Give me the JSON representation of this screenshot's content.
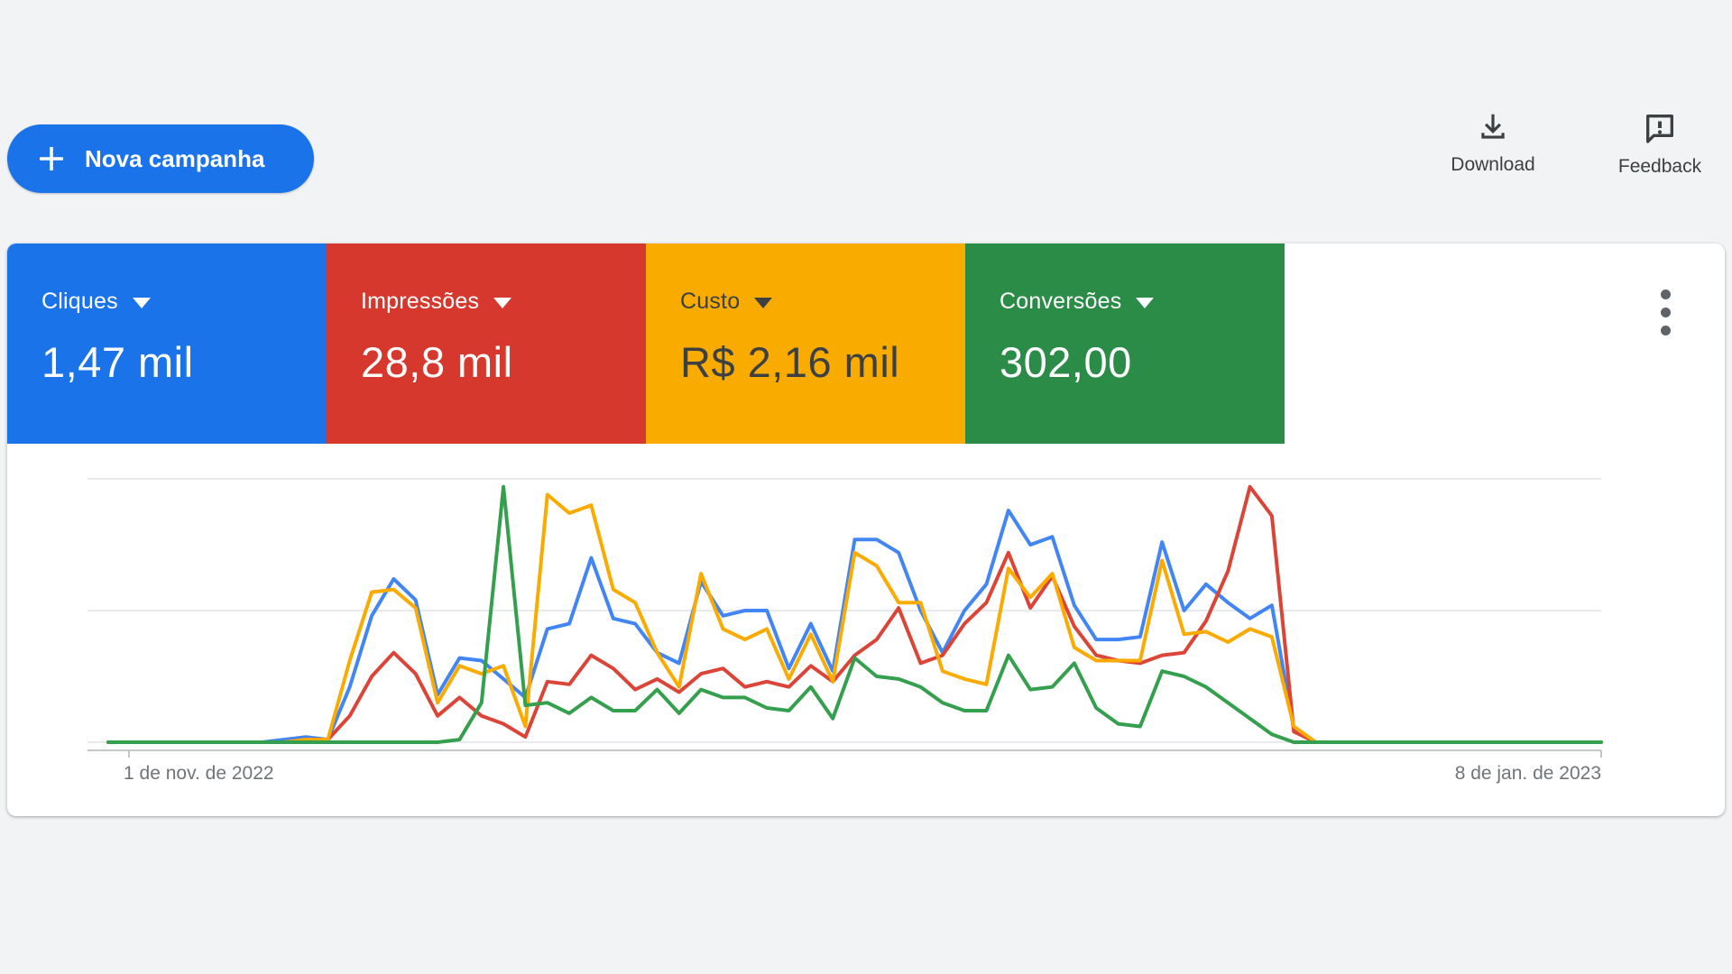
{
  "page": {
    "background": "#F1F3F4"
  },
  "toolbar": {
    "new_campaign_label": "Nova campanha",
    "download_label": "Download",
    "feedback_label": "Feedback"
  },
  "colors": {
    "accent_blue": "#1A73E8",
    "icon_gray": "#5F6368",
    "text_dark": "#3C4043",
    "date_gray": "#70757A",
    "gridline": "#E8EAED",
    "axis": "#C4C7CA"
  },
  "metric_cards": [
    {
      "label": "Cliques",
      "value": "1,47 mil",
      "bg": "#1A73E8",
      "text": "#FFFFFF"
    },
    {
      "label": "Impressões",
      "value": "28,8 mil",
      "bg": "#D6382D",
      "text": "#FFFFFF"
    },
    {
      "label": "Custo",
      "value": "R$ 2,16 mil",
      "bg": "#F9AB00",
      "text": "#3C4043"
    },
    {
      "label": "Conversões",
      "value": "302,00",
      "bg": "#2A8C46",
      "text": "#FFFFFF"
    }
  ],
  "chart_data": {
    "type": "line",
    "title": "",
    "xlabel": "",
    "ylabel": "",
    "x_start_label": "1 de nov. de 2022",
    "x_end_label": "8 de jan. de 2023",
    "x_unit": "day",
    "num_points": 69,
    "ylim": [
      0,
      100
    ],
    "grid": true,
    "gridlines_normalized": [
      0,
      50,
      100
    ],
    "legend_position": "none (series match tile colors)",
    "series": [
      {
        "name": "Cliques",
        "color": "#4285F4",
        "values": [
          0,
          0,
          0,
          0,
          0,
          0,
          0,
          0,
          1,
          2,
          1,
          21,
          48,
          62,
          54,
          18,
          32,
          31,
          24,
          17,
          43,
          45,
          70,
          47,
          45,
          34,
          30,
          61,
          48,
          50,
          50,
          28,
          45,
          27,
          77,
          77,
          72,
          50,
          34,
          50,
          60,
          88,
          75,
          78,
          52,
          39,
          39,
          40,
          76,
          50,
          60,
          53,
          47,
          52,
          5,
          0,
          0,
          0,
          0,
          0,
          0,
          0,
          0,
          0,
          0,
          0,
          0,
          0,
          0
        ]
      },
      {
        "name": "Impressões",
        "color": "#DB4437",
        "values": [
          0,
          0,
          0,
          0,
          0,
          0,
          0,
          0,
          0,
          1,
          1,
          10,
          25,
          34,
          26,
          10,
          17,
          10,
          7,
          2,
          23,
          22,
          33,
          28,
          20,
          24,
          19,
          26,
          28,
          21,
          23,
          21,
          29,
          23,
          33,
          39,
          51,
          30,
          33,
          45,
          53,
          72,
          51,
          63,
          44,
          33,
          31,
          30,
          33,
          34,
          46,
          65,
          97,
          86,
          4,
          0,
          0,
          0,
          0,
          0,
          0,
          0,
          0,
          0,
          0,
          0,
          0,
          0,
          0
        ]
      },
      {
        "name": "Custo",
        "color": "#FBAB00",
        "values": [
          0,
          0,
          0,
          0,
          0,
          0,
          0,
          0,
          0,
          1,
          1,
          31,
          57,
          58,
          51,
          15,
          29,
          26,
          29,
          6,
          94,
          87,
          90,
          58,
          53,
          34,
          21,
          64,
          43,
          39,
          43,
          24,
          41,
          23,
          72,
          67,
          53,
          53,
          27,
          24,
          22,
          66,
          55,
          64,
          36,
          31,
          31,
          31,
          69,
          41,
          42,
          38,
          43,
          40,
          6,
          0,
          0,
          0,
          0,
          0,
          0,
          0,
          0,
          0,
          0,
          0,
          0,
          0,
          0
        ]
      },
      {
        "name": "Conversões",
        "color": "#34A04D",
        "values": [
          0,
          0,
          0,
          0,
          0,
          0,
          0,
          0,
          0,
          0,
          0,
          0,
          0,
          0,
          0,
          0,
          1,
          15,
          97,
          14,
          15,
          11,
          17,
          12,
          12,
          20,
          11,
          20,
          17,
          17,
          13,
          12,
          21,
          9,
          32,
          25,
          24,
          21,
          15,
          12,
          12,
          33,
          20,
          21,
          30,
          13,
          7,
          6,
          27,
          25,
          21,
          15,
          9,
          3,
          0,
          0,
          0,
          0,
          0,
          0,
          0,
          0,
          0,
          0,
          0,
          0,
          0,
          0,
          0
        ]
      }
    ]
  }
}
